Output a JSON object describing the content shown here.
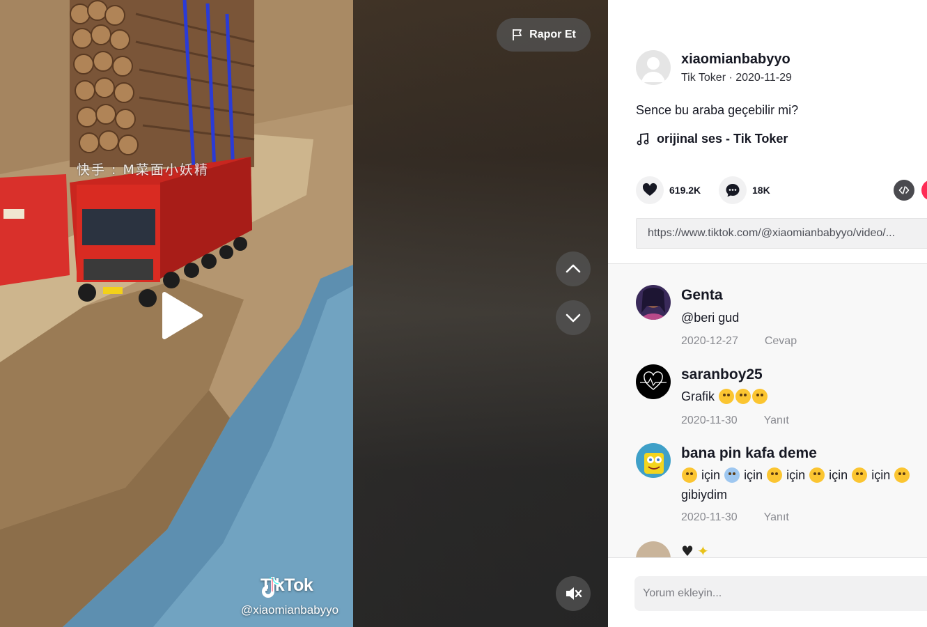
{
  "video": {
    "report_label": "Rapor Et",
    "watermark_brand": "TikTok",
    "watermark_handle": "@xiaomianbabyyo",
    "overlay_text": "快手 : M菜面小妖精"
  },
  "post": {
    "author_name": "xiaomianbabyyo",
    "author_meta": "Tik Toker · 2020-11-29",
    "caption": "Sence bu araba geçebilir mi?",
    "music": "orijinal ses - Tik Toker",
    "likes": "619.2K",
    "comments_count": "18K",
    "link": "https://www.tiktok.com/@xiaomianbabyyo/video/..."
  },
  "comments": [
    {
      "name": "Genta",
      "text": "@beri gud",
      "date": "2020-12-27",
      "reply": "Cevap"
    },
    {
      "name": "saranboy25",
      "text": "Grafik",
      "date": "2020-11-30",
      "reply": "Yanıt"
    },
    {
      "name": "bana pin kafa deme",
      "word": "için",
      "text2": "gibiydim",
      "date": "2020-11-30",
      "reply": "Yanıt"
    }
  ],
  "comment_input": {
    "placeholder": "Yorum ekleyin..."
  },
  "colors": {
    "accent": "#fe2c55",
    "text": "#161823",
    "muted": "#8a8b91"
  },
  "icons": [
    "play-icon",
    "flag-icon",
    "chevron-up-icon",
    "chevron-down-icon",
    "mute-icon",
    "heart-icon",
    "comment-icon",
    "music-note-icon",
    "embed-code-icon",
    "user-icon"
  ]
}
